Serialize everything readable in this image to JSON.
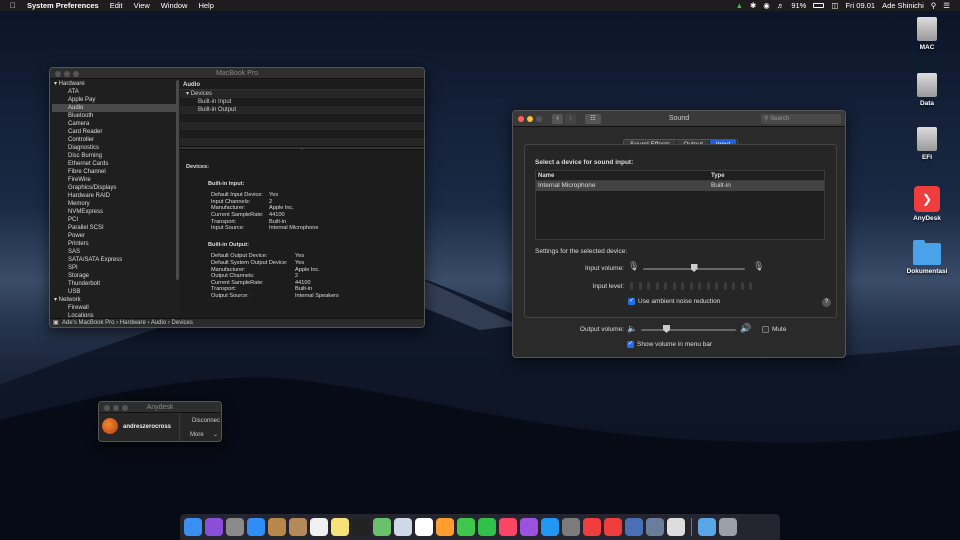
{
  "menubar": {
    "app_name": "System Preferences",
    "menus": [
      "Edit",
      "View",
      "Window",
      "Help"
    ],
    "battery": "91%",
    "clock": "Fri 09.01",
    "user": "Ade Shinichi"
  },
  "sysinfo": {
    "title": "MacBook Pro",
    "sidebar": [
      {
        "label": "Hardware",
        "group": true
      },
      {
        "label": "ATA"
      },
      {
        "label": "Apple Pay"
      },
      {
        "label": "Audio",
        "selected": true
      },
      {
        "label": "Bluetooth"
      },
      {
        "label": "Camera"
      },
      {
        "label": "Card Reader"
      },
      {
        "label": "Controller"
      },
      {
        "label": "Diagnostics"
      },
      {
        "label": "Disc Burning"
      },
      {
        "label": "Ethernet Cards"
      },
      {
        "label": "Fibre Channel"
      },
      {
        "label": "FireWire"
      },
      {
        "label": "Graphics/Displays"
      },
      {
        "label": "Hardware RAID"
      },
      {
        "label": "Memory"
      },
      {
        "label": "NVMExpress"
      },
      {
        "label": "PCI"
      },
      {
        "label": "Parallel SCSI"
      },
      {
        "label": "Power"
      },
      {
        "label": "Printers"
      },
      {
        "label": "SAS"
      },
      {
        "label": "SATA/SATA Express"
      },
      {
        "label": "SPI"
      },
      {
        "label": "Storage"
      },
      {
        "label": "Thunderbolt"
      },
      {
        "label": "USB"
      },
      {
        "label": "Network",
        "group": true
      },
      {
        "label": "Firewall"
      },
      {
        "label": "Locations"
      }
    ],
    "table_header": "Audio",
    "tree": [
      "Devices",
      "Built-in Input",
      "Built-in Output"
    ],
    "details_heading": "Devices:",
    "input_heading": "Built-in Input:",
    "input_props": [
      [
        "Default Input Device:",
        "Yes"
      ],
      [
        "Input Channels:",
        "2"
      ],
      [
        "Manufacturer:",
        "Apple Inc."
      ],
      [
        "Current SampleRate:",
        "44100"
      ],
      [
        "Transport:",
        "Built-in"
      ],
      [
        "Input Source:",
        "Internal Microphone"
      ]
    ],
    "output_heading": "Built-in Output:",
    "output_props": [
      [
        "Default Output Device:",
        "Yes"
      ],
      [
        "Default System Output Device:",
        "Yes"
      ],
      [
        "Manufacturer:",
        "Apple Inc."
      ],
      [
        "Output Channels:",
        "2"
      ],
      [
        "Current SampleRate:",
        "44100"
      ],
      [
        "Transport:",
        "Built-in"
      ],
      [
        "Output Source:",
        "Internal Speakers"
      ]
    ],
    "breadcrumb": "Ade's MacBook Pro › Hardware › Audio › Devices"
  },
  "sound": {
    "title": "Sound",
    "search_placeholder": "Search",
    "tabs": [
      "Sound Effects",
      "Output",
      "Input"
    ],
    "active_tab": 2,
    "device_prompt": "Select a device for sound input:",
    "col_name": "Name",
    "col_type": "Type",
    "devices": [
      {
        "name": "Internal Microphone",
        "type": "Built-in"
      }
    ],
    "settings_label": "Settings for the selected device:",
    "input_volume_label": "Input volume:",
    "input_volume": 0.5,
    "input_level_label": "Input level:",
    "noise_label": "Use ambient noise reduction",
    "noise_checked": true,
    "help": "?",
    "output_volume_label": "Output volume:",
    "output_volume": 0.25,
    "mute_label": "Mute",
    "mute_checked": false,
    "menubar_label": "Show volume in menu bar",
    "menubar_checked": true
  },
  "anydesk": {
    "title": "Anydesk",
    "user": "andreszerocross",
    "disconnect": "Disconnec",
    "more": "More"
  },
  "desktop_icons": [
    {
      "label": "MAC",
      "icon": "drive-icon"
    },
    {
      "label": "Data",
      "icon": "drive-icon"
    },
    {
      "label": "EFI",
      "icon": "drive-icon"
    },
    {
      "label": "AnyDesk",
      "icon": "anydesk-icon"
    },
    {
      "label": "Dokumentasi",
      "icon": "folder-icon"
    }
  ],
  "dock": [
    {
      "name": "finder",
      "color": "#3b8ff0"
    },
    {
      "name": "siri",
      "color": "#8a4fd8"
    },
    {
      "name": "launchpad",
      "color": "#8a8a8a"
    },
    {
      "name": "safari",
      "color": "#2f8df5"
    },
    {
      "name": "mail-stamp",
      "color": "#b8874a"
    },
    {
      "name": "contacts",
      "color": "#b48a5a"
    },
    {
      "name": "calendar",
      "color": "#f0f0f0"
    },
    {
      "name": "notes",
      "color": "#f7e27a"
    },
    {
      "name": "terminal",
      "color": "#222222"
    },
    {
      "name": "maps",
      "color": "#6bc06b"
    },
    {
      "name": "preview",
      "color": "#cfd8e6"
    },
    {
      "name": "reminders",
      "color": "#ffffff"
    },
    {
      "name": "photos",
      "color": "#ff9e2c"
    },
    {
      "name": "messages",
      "color": "#3ec74b"
    },
    {
      "name": "facetime",
      "color": "#2fc14a"
    },
    {
      "name": "music",
      "color": "#fa4565"
    },
    {
      "name": "podcasts",
      "color": "#9b52e0"
    },
    {
      "name": "app-store",
      "color": "#2196f3"
    },
    {
      "name": "system-preferences",
      "color": "#7b7b7b"
    },
    {
      "name": "anydesk",
      "color": "#ef3c3c"
    },
    {
      "name": "anydesk-2",
      "color": "#ef3c3c"
    },
    {
      "name": "system-information",
      "color": "#4a6fb5"
    },
    {
      "name": "network-utility",
      "color": "#6a7d9c"
    },
    {
      "name": "airport-utility",
      "color": "#dddddd"
    },
    {
      "name": "downloads-folder",
      "color": "#5aa7e8"
    },
    {
      "name": "trash",
      "color": "#9aa0a8"
    }
  ]
}
